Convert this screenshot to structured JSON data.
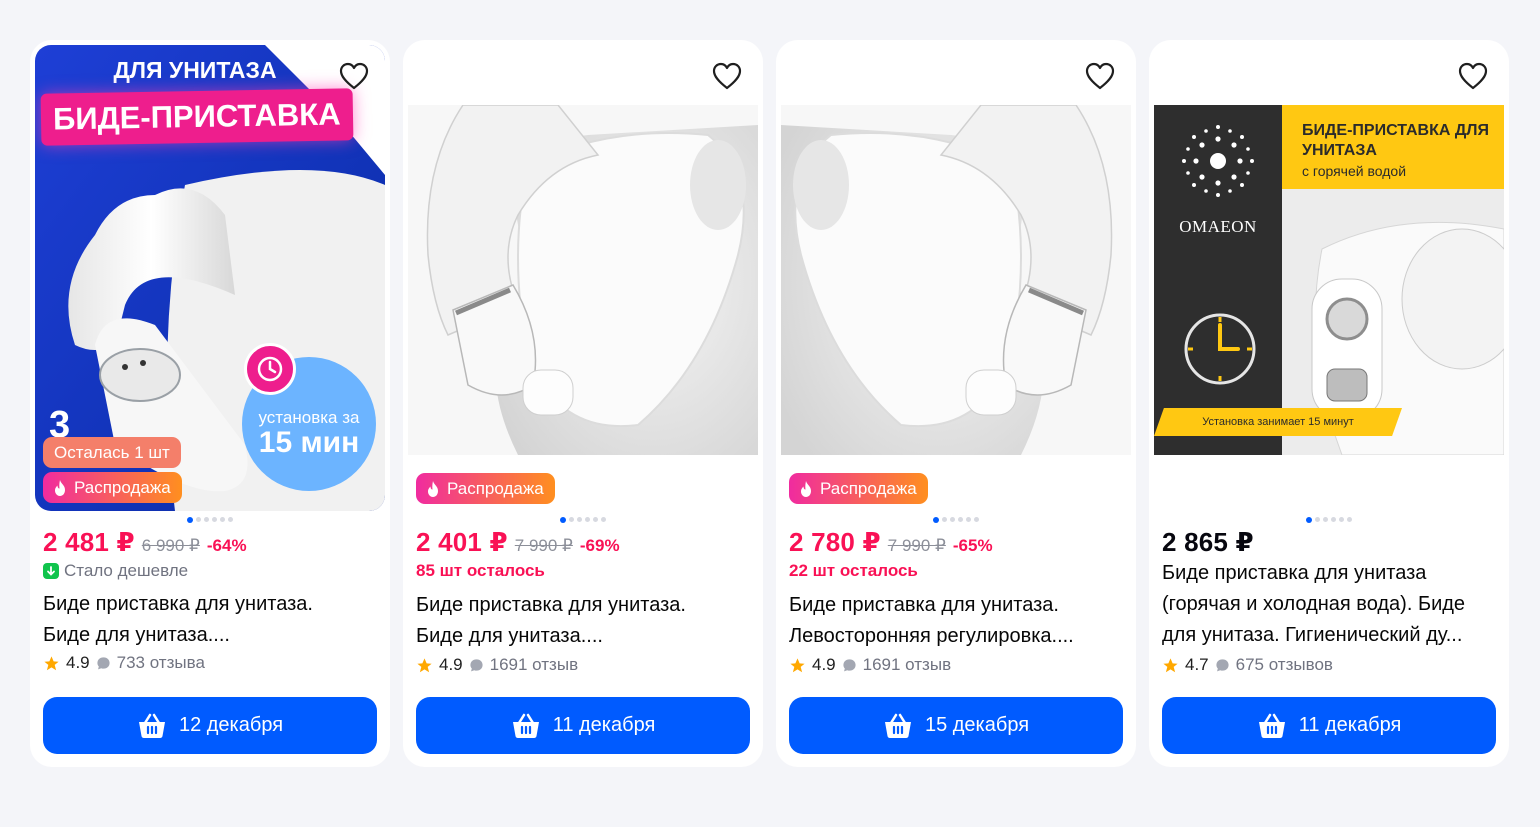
{
  "colors": {
    "accent": "#005bff",
    "price": "#f91155",
    "sale_gradient": [
      "#f02b9f",
      "#ff8f1f"
    ],
    "stock_left": "#f47f6a",
    "cheaper": "#10c44c"
  },
  "icons": {
    "favorite": "heart-icon",
    "buy": "basket-icon",
    "rating": "star-icon",
    "reviews": "comment-icon",
    "sale": "flame-icon",
    "cheaper": "arrow-down-icon"
  },
  "cards": [
    {
      "image": {
        "promo_top": "ДЛЯ УНИТАЗА",
        "promo_main": "БИДЕ-ПРИСТАВКА",
        "install_text": "установка за",
        "install_time": "15 мин",
        "side_text": "3"
      },
      "badge_left": "Осталась 1 шт",
      "badge_sale": "Распродажа",
      "price": "2 481 ₽",
      "old_price": "6 990 ₽",
      "discount": "-64%",
      "sub_text": "Стало дешевле",
      "title_line1": "Биде приставка для унитаза.",
      "title_line2": "Биде для унитаза....",
      "rating": "4.9",
      "reviews": "733 отзыва",
      "button": "12 декабря"
    },
    {
      "badge_sale": "Распродажа",
      "price": "2 401 ₽",
      "old_price": "7 990 ₽",
      "discount": "-69%",
      "sub_text": "85 шт осталось",
      "title_line1": "Биде приставка для унитаза.",
      "title_line2": "Биде для унитаза....",
      "rating": "4.9",
      "reviews": "1691 отзыв",
      "button": "11 декабря"
    },
    {
      "badge_sale": "Распродажа",
      "price": "2 780 ₽",
      "old_price": "7 990 ₽",
      "discount": "-65%",
      "sub_text": "22 шт осталось",
      "title_line1": "Биде приставка для унитаза.",
      "title_line2": "Левосторонняя регулировка....",
      "rating": "4.9",
      "reviews": "1691 отзыв",
      "button": "15 декабря"
    },
    {
      "image": {
        "heading": "БИДЕ-ПРИСТАВКА ДЛЯ УНИТАЗА",
        "subheading": "с горячей водой",
        "brand": "OMAEON",
        "install_note": "Установка занимает 15 минут"
      },
      "price": "2 865 ₽",
      "title_line1": "Биде приставка для унитаза",
      "title_line2": "(горячая и холодная вода). Биде",
      "title_line3": "для унитаза. Гигиенический ду...",
      "rating": "4.7",
      "reviews": "675 отзывов",
      "button": "11 декабря"
    }
  ]
}
